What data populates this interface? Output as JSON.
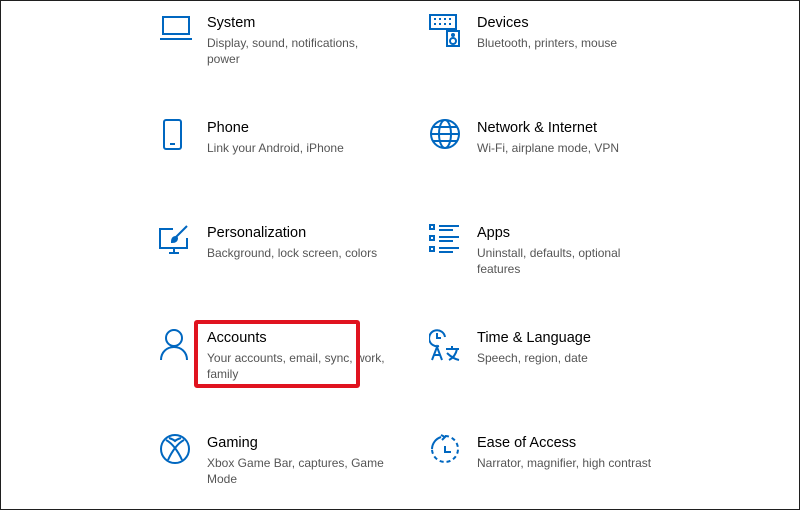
{
  "accent_color": "#0067c0",
  "highlight_color": "#e0131f",
  "tiles": [
    {
      "id": "system",
      "icon": "laptop-icon",
      "title": "System",
      "desc": "Display, sound, notifications, power"
    },
    {
      "id": "devices",
      "icon": "keyboard-speaker-icon",
      "title": "Devices",
      "desc": "Bluetooth, printers, mouse"
    },
    {
      "id": "phone",
      "icon": "phone-icon",
      "title": "Phone",
      "desc": "Link your Android, iPhone"
    },
    {
      "id": "network",
      "icon": "globe-icon",
      "title": "Network & Internet",
      "desc": "Wi-Fi, airplane mode, VPN"
    },
    {
      "id": "personalization",
      "icon": "paint-monitor-icon",
      "title": "Personalization",
      "desc": "Background, lock screen, colors"
    },
    {
      "id": "apps",
      "icon": "apps-list-icon",
      "title": "Apps",
      "desc": "Uninstall, defaults, optional features"
    },
    {
      "id": "accounts",
      "icon": "person-icon",
      "title": "Accounts",
      "desc": "Your accounts, email, sync, work, family"
    },
    {
      "id": "time",
      "icon": "time-language-icon",
      "title": "Time & Language",
      "desc": "Speech, region, date"
    },
    {
      "id": "gaming",
      "icon": "xbox-icon",
      "title": "Gaming",
      "desc": "Xbox Game Bar, captures, Game Mode"
    },
    {
      "id": "ease",
      "icon": "ease-of-access-icon",
      "title": "Ease of Access",
      "desc": "Narrator, magnifier, high contrast"
    }
  ]
}
